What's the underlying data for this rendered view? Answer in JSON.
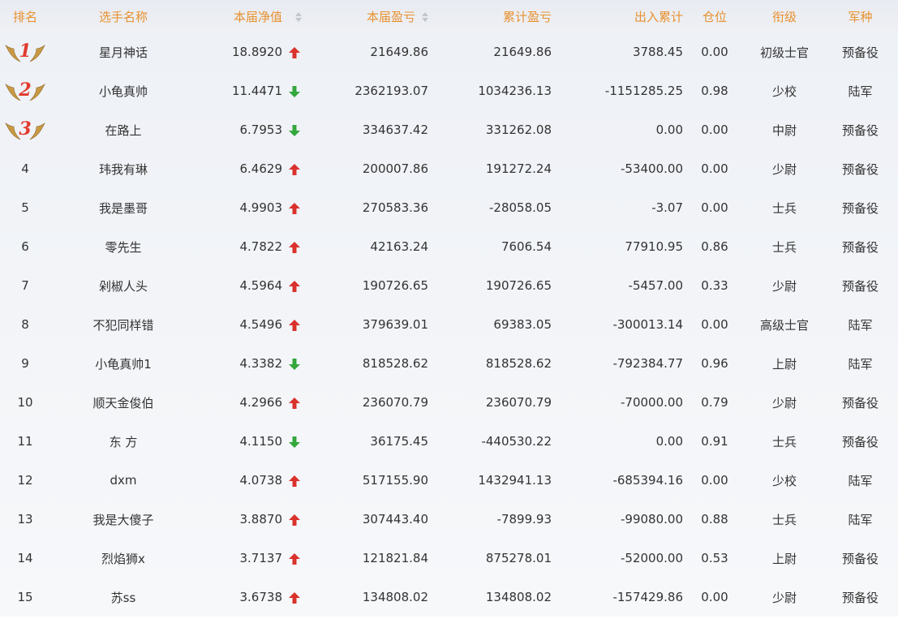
{
  "header": {
    "rank": "排名",
    "name": "选手名称",
    "nav": "本届净值",
    "pnl": "本届盈亏",
    "total": "累计盈亏",
    "flow": "出入累计",
    "position": "仓位",
    "title": "衔级",
    "army": "军种"
  },
  "colors": {
    "header_text": "#e8912f",
    "up_arrow": "#d9322c",
    "down_arrow": "#33a63c",
    "medal_red": "#e23a2f",
    "medal_gold": "#c99a44"
  },
  "rows": [
    {
      "rank": "1",
      "medal": true,
      "name": "星月神话",
      "nav": "18.8920",
      "trend": "up",
      "pnl": "21649.86",
      "total": "21649.86",
      "flow": "3788.45",
      "position": "0.00",
      "title": "初级士官",
      "army": "预备役"
    },
    {
      "rank": "2",
      "medal": true,
      "name": "小龟真帅",
      "nav": "11.4471",
      "trend": "down",
      "pnl": "2362193.07",
      "total": "1034236.13",
      "flow": "-1151285.25",
      "position": "0.98",
      "title": "少校",
      "army": "陆军"
    },
    {
      "rank": "3",
      "medal": true,
      "name": "在路上",
      "nav": "6.7953",
      "trend": "down",
      "pnl": "334637.42",
      "total": "331262.08",
      "flow": "0.00",
      "position": "0.00",
      "title": "中尉",
      "army": "预备役"
    },
    {
      "rank": "4",
      "medal": false,
      "name": "玮我有琳",
      "nav": "6.4629",
      "trend": "up",
      "pnl": "200007.86",
      "total": "191272.24",
      "flow": "-53400.00",
      "position": "0.00",
      "title": "少尉",
      "army": "预备役"
    },
    {
      "rank": "5",
      "medal": false,
      "name": "我是墨哥",
      "nav": "4.9903",
      "trend": "up",
      "pnl": "270583.36",
      "total": "-28058.05",
      "flow": "-3.07",
      "position": "0.00",
      "title": "士兵",
      "army": "预备役"
    },
    {
      "rank": "6",
      "medal": false,
      "name": "零先生",
      "nav": "4.7822",
      "trend": "up",
      "pnl": "42163.24",
      "total": "7606.54",
      "flow": "77910.95",
      "position": "0.86",
      "title": "士兵",
      "army": "预备役"
    },
    {
      "rank": "7",
      "medal": false,
      "name": "剁椒人头",
      "nav": "4.5964",
      "trend": "up",
      "pnl": "190726.65",
      "total": "190726.65",
      "flow": "-5457.00",
      "position": "0.33",
      "title": "少尉",
      "army": "预备役"
    },
    {
      "rank": "8",
      "medal": false,
      "name": "不犯同样错",
      "nav": "4.5496",
      "trend": "up",
      "pnl": "379639.01",
      "total": "69383.05",
      "flow": "-300013.14",
      "position": "0.00",
      "title": "高级士官",
      "army": "陆军"
    },
    {
      "rank": "9",
      "medal": false,
      "name": "小龟真帅1",
      "nav": "4.3382",
      "trend": "down",
      "pnl": "818528.62",
      "total": "818528.62",
      "flow": "-792384.77",
      "position": "0.96",
      "title": "上尉",
      "army": "陆军"
    },
    {
      "rank": "10",
      "medal": false,
      "name": "顺天金俊伯",
      "nav": "4.2966",
      "trend": "up",
      "pnl": "236070.79",
      "total": "236070.79",
      "flow": "-70000.00",
      "position": "0.79",
      "title": "少尉",
      "army": "预备役"
    },
    {
      "rank": "11",
      "medal": false,
      "name": "东 方",
      "nav": "4.1150",
      "trend": "down",
      "pnl": "36175.45",
      "total": "-440530.22",
      "flow": "0.00",
      "position": "0.91",
      "title": "士兵",
      "army": "预备役"
    },
    {
      "rank": "12",
      "medal": false,
      "name": "dxm",
      "nav": "4.0738",
      "trend": "up",
      "pnl": "517155.90",
      "total": "1432941.13",
      "flow": "-685394.16",
      "position": "0.00",
      "title": "少校",
      "army": "陆军"
    },
    {
      "rank": "13",
      "medal": false,
      "name": "我是大傻子",
      "nav": "3.8870",
      "trend": "up",
      "pnl": "307443.40",
      "total": "-7899.93",
      "flow": "-99080.00",
      "position": "0.88",
      "title": "士兵",
      "army": "陆军"
    },
    {
      "rank": "14",
      "medal": false,
      "name": "烈焰狮x",
      "nav": "3.7137",
      "trend": "up",
      "pnl": "121821.84",
      "total": "875278.01",
      "flow": "-52000.00",
      "position": "0.53",
      "title": "上尉",
      "army": "预备役"
    },
    {
      "rank": "15",
      "medal": false,
      "name": "苏ss",
      "nav": "3.6738",
      "trend": "up",
      "pnl": "134808.02",
      "total": "134808.02",
      "flow": "-157429.86",
      "position": "0.00",
      "title": "少尉",
      "army": "预备役"
    }
  ]
}
